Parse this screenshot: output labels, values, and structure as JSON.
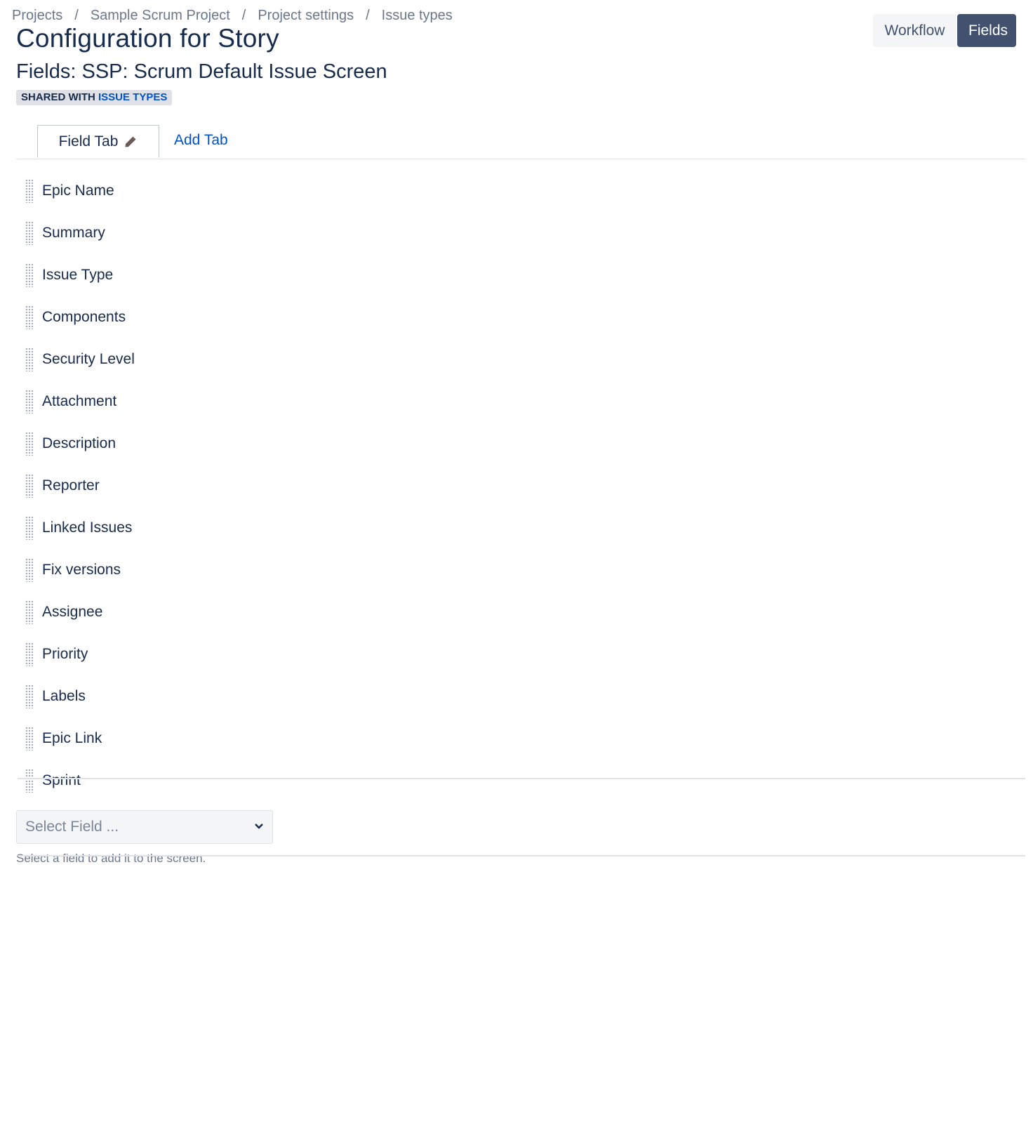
{
  "breadcrumbs": [
    "Projects",
    "Sample Scrum Project",
    "Project settings",
    "Issue types"
  ],
  "breadcrumb_separator": "/",
  "header": {
    "title": "Configuration for Story",
    "workflow_button": "Workflow",
    "fields_button": "Fields"
  },
  "screen": {
    "title": "Fields: SSP: Scrum Default Issue Screen",
    "shared_prefix": "SHARED WITH",
    "shared_link": "ISSUE TYPES"
  },
  "tabs": {
    "active_tab": "Field Tab",
    "add_tab": "Add Tab"
  },
  "fields": [
    "Epic Name",
    "Summary",
    "Issue Type",
    "Components",
    "Security Level",
    "Attachment",
    "Description",
    "Reporter",
    "Linked Issues",
    "Fix versions",
    "Assignee",
    "Priority",
    "Labels",
    "Epic Link",
    "Sprint"
  ],
  "add_field": {
    "placeholder": "Select Field ...",
    "hint": "Select a field to add it to the screen."
  },
  "icons": {
    "tab_edit": "pencil-icon",
    "drag": "drag-handle-icon",
    "select": "chevron-down-icon"
  },
  "colors": {
    "primary_text": "#172b4d",
    "link": "#0052cc",
    "selected_button_bg": "#42526e",
    "subtle_bg": "#f4f5f7"
  }
}
